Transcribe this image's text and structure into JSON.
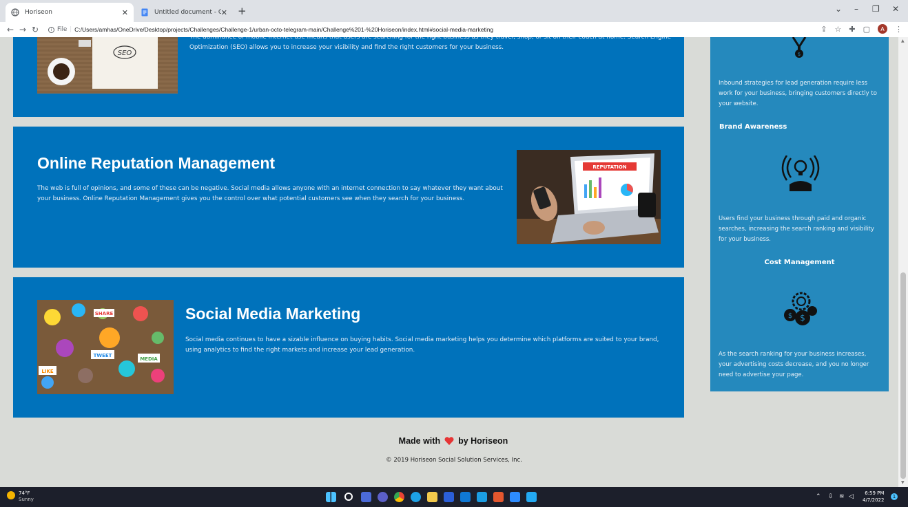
{
  "browser": {
    "tabs": [
      {
        "title": "Horiseon",
        "active": true
      },
      {
        "title": "Untitled document - Google Doc",
        "active": false
      }
    ],
    "url_info": "File",
    "url": "C:/Users/amhas/OneDrive/Desktop/projects/Challenges/Challenge-1/urban-octo-telegram-main/Challenge%201-%20Horiseon/index.html#social-media-marketing",
    "avatar_letter": "A",
    "window_controls": {
      "minimize": "–",
      "maximize": "❐",
      "close": "✕",
      "menu": "⌄"
    }
  },
  "sections": {
    "seo": {
      "text": "The dominance of mobile internet use means that users are searching for the right business as they travel, shop, or sit on their couch at home. Search Engine Optimization (SEO) allows you to increase your visibility and find the right customers for your business.",
      "image_label": "SEO"
    },
    "reputation": {
      "title": "Online Reputation Management",
      "text": "The web is full of opinions, and some of these can be negative. Social media allows anyone with an internet connection to say whatever they want about your business. Online Reputation Management gives you the control over what potential customers see when they search for your business.",
      "image_label": "REPUTATION"
    },
    "social": {
      "title": "Social Media Marketing",
      "text": "Social media continues to have a sizable influence on buying habits. Social media marketing helps you determine which platforms are suited to your brand, using analytics to find the right markets and increase your lead generation.",
      "image_labels": [
        "SHARE",
        "TWEET",
        "LIKE",
        "MEDIA"
      ]
    }
  },
  "benefits": {
    "lead_text": "Inbound strategies for lead generation require less work for your business, bringing customers directly to your website.",
    "brand_title": "Brand Awareness",
    "brand_text": "Users find your business through paid and organic searches, increasing the search ranking and visibility for your business.",
    "cost_title": "Cost Management",
    "cost_text": "As the search ranking for your business increases, your advertising costs decrease, and you no longer need to advertise your page."
  },
  "footer": {
    "made_prefix": "Made with",
    "made_suffix": "by Horiseon",
    "copyright": "© 2019 Horiseon Social Solution Services, Inc."
  },
  "taskbar": {
    "temp": "74°F",
    "weather": "Sunny",
    "time": "6:59 PM",
    "date": "4/7/2022",
    "notification_count": "1"
  },
  "colors": {
    "card_blue": "#0072bb",
    "aside_blue": "#2589bd",
    "page_bg": "#d9dbd7",
    "heart": "#e63535"
  }
}
